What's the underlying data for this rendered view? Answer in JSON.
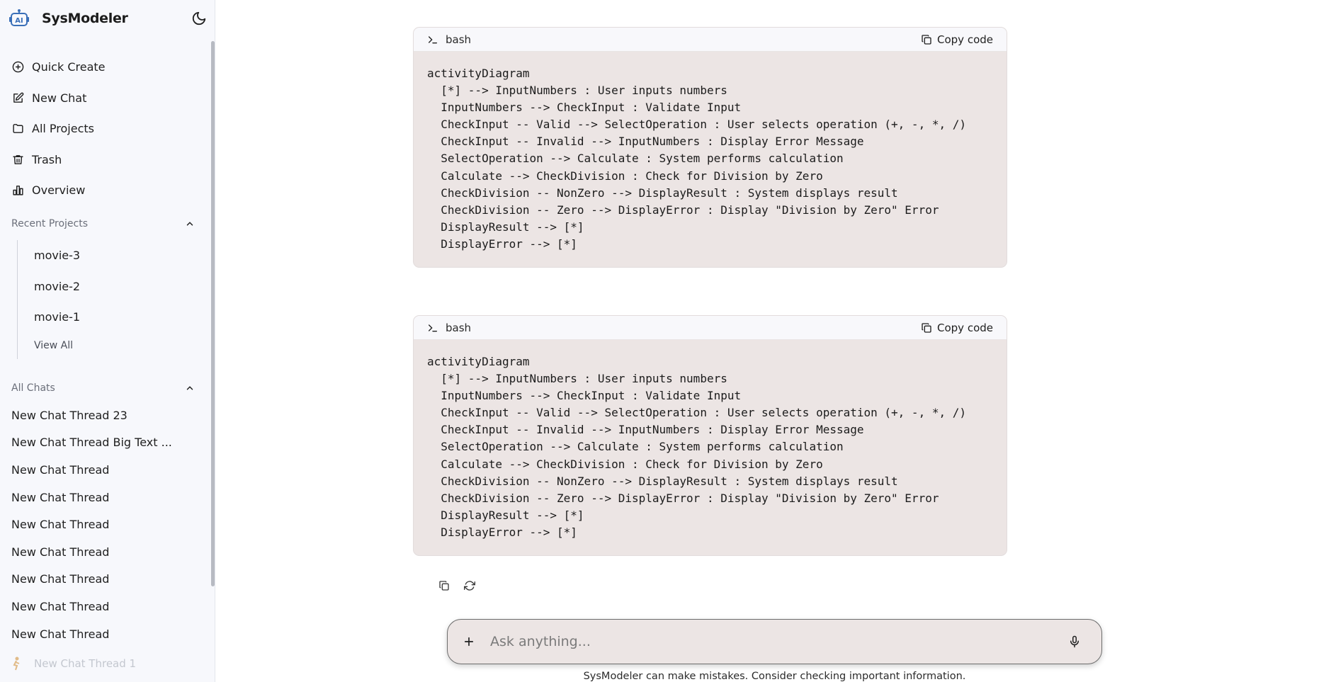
{
  "brand": {
    "name": "SysModeler",
    "logo_icon": "ai-robot-logo-icon"
  },
  "theme_toggle_icon": "moon-icon",
  "nav": [
    {
      "label": "Quick Create",
      "icon": "plus-circle-icon"
    },
    {
      "label": "New Chat",
      "icon": "edit-icon"
    },
    {
      "label": "All Projects",
      "icon": "folder-icon"
    },
    {
      "label": "Trash",
      "icon": "trash-icon"
    },
    {
      "label": "Overview",
      "icon": "bar-chart-icon"
    }
  ],
  "recent_projects": {
    "title": "Recent Projects",
    "items": [
      "movie-3",
      "movie-2",
      "movie-1"
    ],
    "view_all": "View All"
  },
  "all_chats": {
    "title": "All Chats",
    "items": [
      "New Chat Thread 23",
      "New Chat Thread Big Text ...",
      "New Chat Thread",
      "New Chat Thread",
      "New Chat Thread",
      "New Chat Thread",
      "New Chat Thread",
      "New Chat Thread",
      "New Chat Thread"
    ]
  },
  "user": {
    "name": "New Chat Thread 1"
  },
  "code_blocks": [
    {
      "lang": "bash",
      "copy_label": "Copy code",
      "lines": [
        "activityDiagram",
        "  [*] --> InputNumbers : User inputs numbers",
        "  InputNumbers --> CheckInput : Validate Input",
        "  CheckInput -- Valid --> SelectOperation : User selects operation (+, -, *, /)",
        "  CheckInput -- Invalid --> InputNumbers : Display Error Message",
        "  SelectOperation --> Calculate : System performs calculation",
        "  Calculate --> CheckDivision : Check for Division by Zero",
        "  CheckDivision -- NonZero --> DisplayResult : System displays result",
        "  CheckDivision -- Zero --> DisplayError : Display \"Division by Zero\" Error",
        "  DisplayResult --> [*]",
        "  DisplayError --> [*]"
      ]
    },
    {
      "lang": "bash",
      "copy_label": "Copy code",
      "lines": [
        "activityDiagram",
        "  [*] --> InputNumbers : User inputs numbers",
        "  InputNumbers --> CheckInput : Validate Input",
        "  CheckInput -- Valid --> SelectOperation : User selects operation (+, -, *, /)",
        "  CheckInput -- Invalid --> InputNumbers : Display Error Message",
        "  SelectOperation --> Calculate : System performs calculation",
        "  Calculate --> CheckDivision : Check for Division by Zero",
        "  CheckDivision -- NonZero --> DisplayResult : System displays result",
        "  CheckDivision -- Zero --> DisplayError : Display \"Division by Zero\" Error",
        "  DisplayResult --> [*]",
        "  DisplayError --> [*]"
      ]
    }
  ],
  "composer": {
    "placeholder": "Ask anything..."
  },
  "disclaimer": "SysModeler can make mistakes. Consider checking important information.",
  "colors": {
    "code_bg": "#ece5e4",
    "sidebar_bg": "#f7f8fc",
    "logo_blue": "#3a6fb8"
  }
}
